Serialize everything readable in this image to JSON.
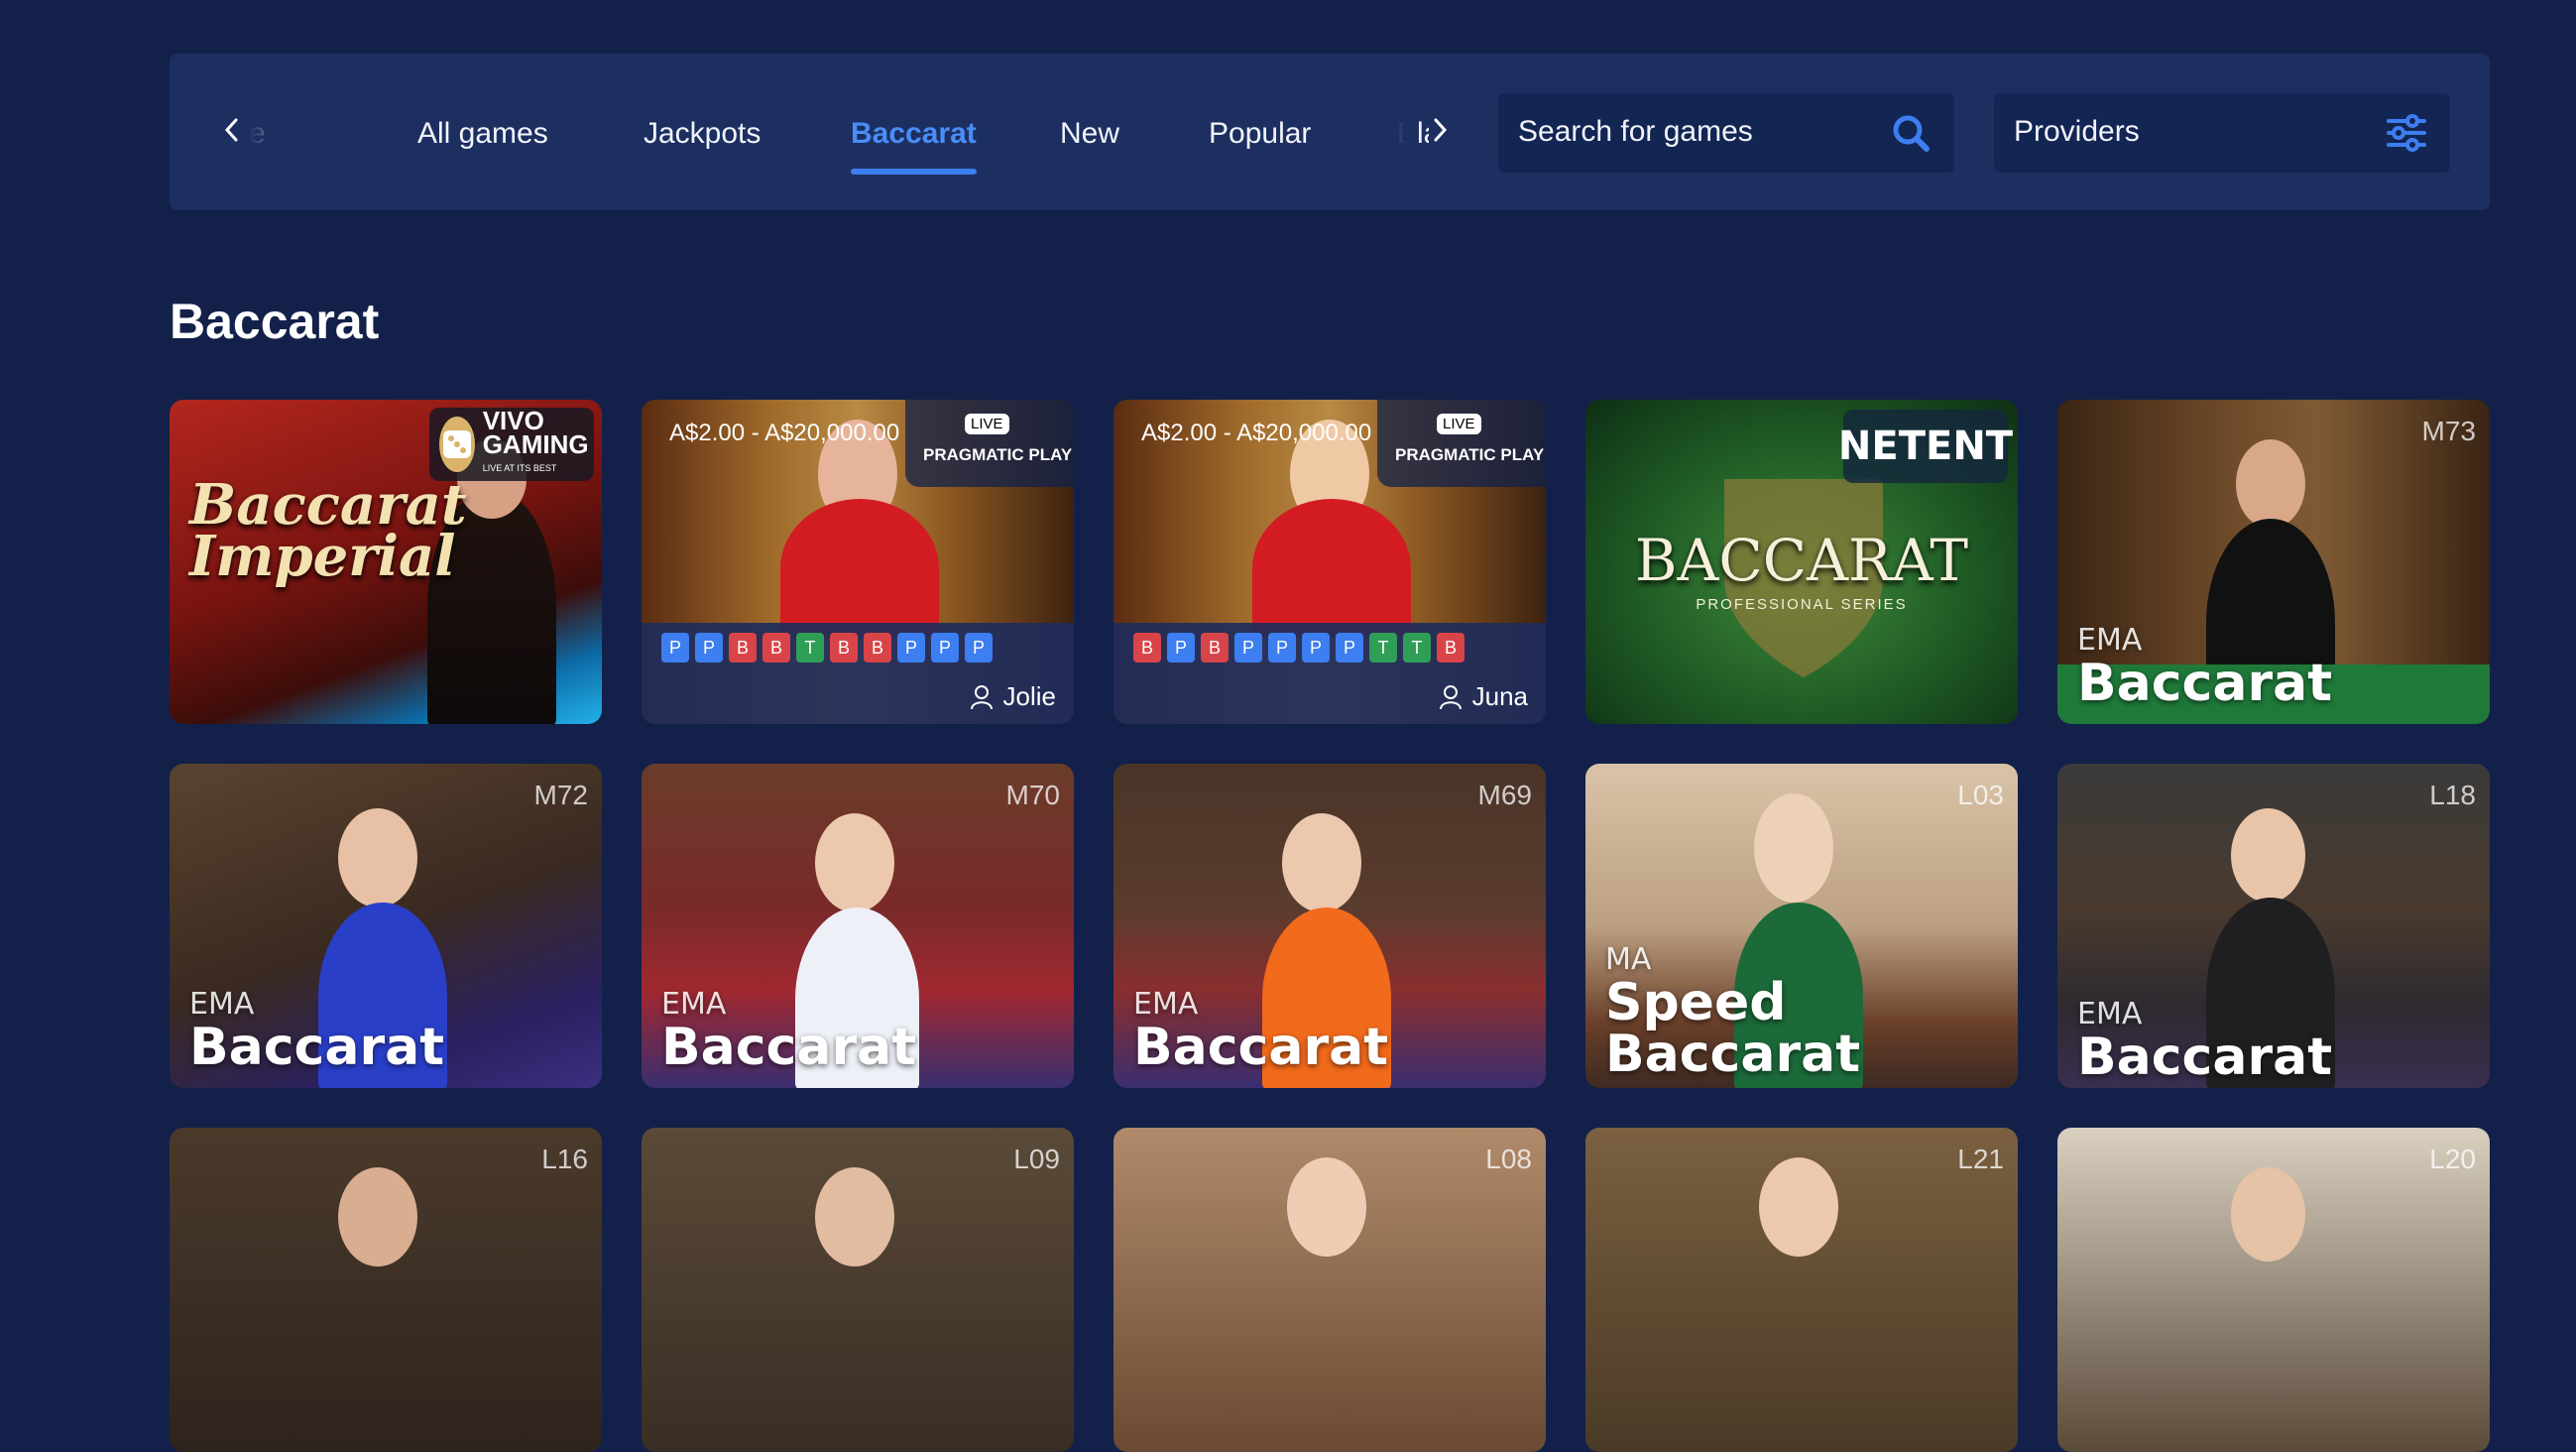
{
  "nav": {
    "tabs": [
      {
        "label": "All games",
        "active": false
      },
      {
        "label": "Jackpots",
        "active": false
      },
      {
        "label": "Baccarat",
        "active": true
      },
      {
        "label": "New",
        "active": false
      },
      {
        "label": "Popular",
        "active": false
      },
      {
        "label": "BlackJack",
        "active": false
      }
    ],
    "search_placeholder": "Search for games",
    "providers_label": "Providers"
  },
  "section_title": "Baccarat",
  "tiles_row1": {
    "tile1": {
      "provider": "VIVO GAMING",
      "provider_sub": "LIVE AT ITS BEST",
      "game": "Baccarat Imperial"
    },
    "tile2": {
      "limits": "A$2.00 - A$20,000.00",
      "provider": "PRAGMATIC PLAY",
      "live": "LIVE",
      "dealer": "Jolie",
      "road": [
        "P",
        "P",
        "B",
        "B",
        "T",
        "B",
        "B",
        "P",
        "P",
        "P"
      ]
    },
    "tile3": {
      "limits": "A$2.00 - A$20,000.00",
      "provider": "PRAGMATIC PLAY",
      "live": "LIVE",
      "dealer": "Juna",
      "road": [
        "B",
        "P",
        "B",
        "P",
        "P",
        "P",
        "P",
        "T",
        "T",
        "B"
      ]
    },
    "tile4": {
      "provider": "NETENT",
      "game": "BACCARAT",
      "game_sub": "PROFESSIONAL SERIES"
    },
    "tile5": {
      "code": "M73",
      "brand": "EMA",
      "game": "Baccarat"
    }
  },
  "tiles_row2": [
    {
      "code": "M72",
      "brand": "EMA",
      "game": "Baccarat"
    },
    {
      "code": "M70",
      "brand": "EMA",
      "game": "Baccarat"
    },
    {
      "code": "M69",
      "brand": "EMA",
      "game": "Baccarat"
    },
    {
      "code": "L03",
      "brand": "MA",
      "game_line1": "Speed",
      "game_line2": "Baccarat"
    },
    {
      "code": "L18",
      "brand": "EMA",
      "game": "Baccarat"
    }
  ],
  "tiles_row3": [
    {
      "code": "L16"
    },
    {
      "code": "L09"
    },
    {
      "code": "L08"
    },
    {
      "code": "L21"
    },
    {
      "code": "L20"
    }
  ],
  "colors": {
    "page_bg": "#13214a",
    "bar_bg": "#1d2f61",
    "accent": "#3d7ef0",
    "player": "#3d7ef0",
    "banker": "#d94448",
    "tie": "#2f9e57"
  }
}
